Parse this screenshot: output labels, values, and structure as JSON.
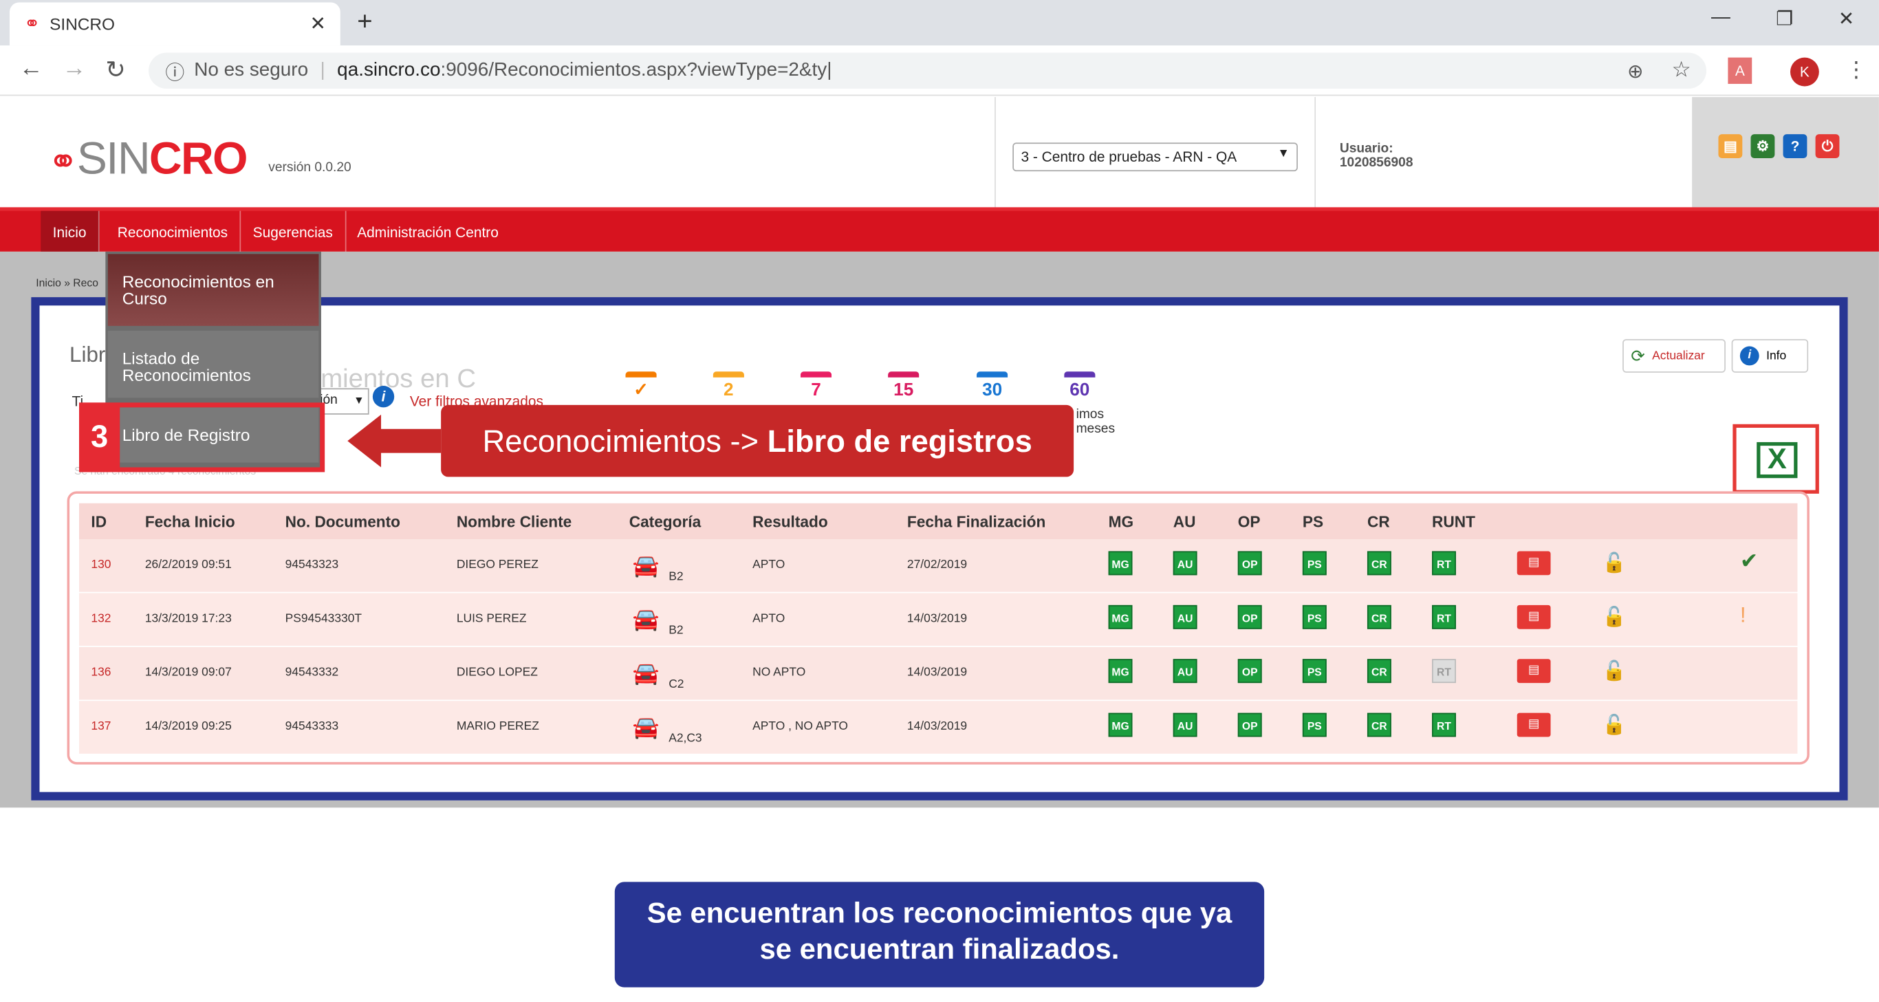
{
  "browser": {
    "tab_title": "SINCRO",
    "security": "No es seguro",
    "url_host": "qa.sincro.co",
    "url_rest": ":9096/Reconocimientos.aspx?viewType=2&ty|",
    "profile_initial": "K"
  },
  "header": {
    "logo_sin": "SIN",
    "logo_cro": "CRO",
    "version": "versión 0.0.20",
    "center": "3 - Centro de pruebas - ARN - QA",
    "user_label": "Usuario:",
    "user_id": "1020856908"
  },
  "nav": {
    "items": [
      "Inicio",
      "Reconocimientos",
      "Sugerencias",
      "Administración Centro"
    ]
  },
  "breadcrumb": "Inicio » Reco",
  "dropdown": {
    "item1": "Reconocimientos en Curso",
    "item2": "Listado de Reconocimientos",
    "item3": "Libro de Registro"
  },
  "page": {
    "title_fragment": "Libr",
    "ghost_title": "onocimientos en C",
    "filter_fragment_left": "Ti",
    "filter_fragment_select": "ión",
    "advanced_filters": "Ver filtros avanzados",
    "search_placeholder": "Co",
    "caption_fragment": "Se han encontrado 4 reconocimientos",
    "calendar_last_label": "imos\nmeses"
  },
  "calendars": [
    "✓",
    "2",
    "7",
    "15",
    "30",
    "60"
  ],
  "actions": {
    "refresh": "Actualizar",
    "info": "Info"
  },
  "table": {
    "headers": [
      "ID",
      "Fecha Inicio",
      "No. Documento",
      "Nombre Cliente",
      "Categoría",
      "Resultado",
      "Fecha Finalización",
      "MG",
      "AU",
      "OP",
      "PS",
      "CR",
      "RUNT"
    ],
    "rows": [
      {
        "id": "130",
        "inicio": "26/2/2019 09:51",
        "doc": "94543323",
        "cliente": "DIEGO PEREZ",
        "cat": "B2",
        "resultado": "APTO",
        "fin": "27/02/2019"
      },
      {
        "id": "132",
        "inicio": "13/3/2019 17:23",
        "doc": "PS94543330T",
        "cliente": "LUIS PEREZ",
        "cat": "B2",
        "resultado": "APTO",
        "fin": "14/03/2019"
      },
      {
        "id": "136",
        "inicio": "14/3/2019 09:07",
        "doc": "94543332",
        "cliente": "DIEGO LOPEZ",
        "cat": "C2",
        "resultado": "NO APTO",
        "fin": "14/03/2019"
      },
      {
        "id": "137",
        "inicio": "14/3/2019 09:25",
        "doc": "94543333",
        "cliente": "MARIO PEREZ",
        "cat": "A2,C3",
        "resultado": "APTO , NO APTO",
        "fin": "14/03/2019"
      }
    ],
    "badges": [
      "MG",
      "AU",
      "OP",
      "PS",
      "CR",
      "RT"
    ]
  },
  "callout": {
    "step": "3",
    "text_normal": "Reconocimientos -> ",
    "text_bold": "Libro de registros"
  },
  "note": {
    "line1": "Se encuentran los reconocimientos que ya",
    "line2": "se encuentran finalizados."
  }
}
